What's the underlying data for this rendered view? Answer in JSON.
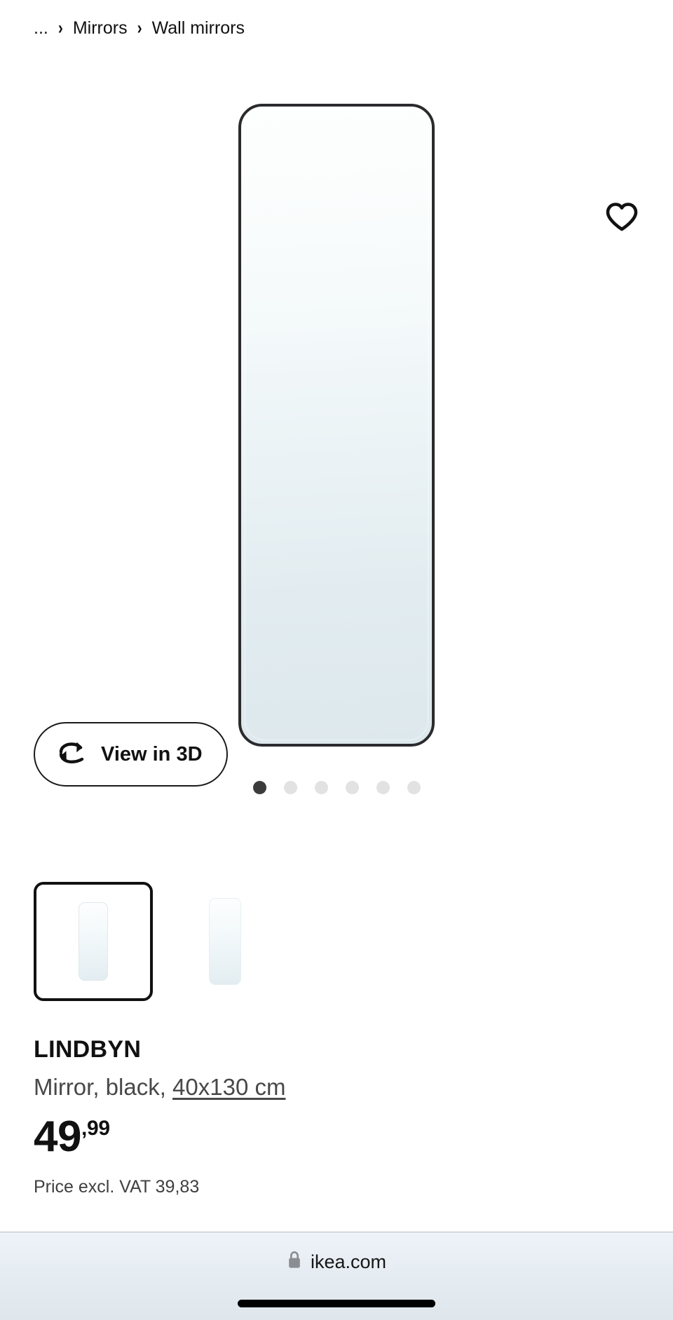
{
  "breadcrumb": {
    "items": [
      {
        "label": "...",
        "name": "breadcrumb-ellipsis"
      },
      {
        "label": "Mirrors",
        "name": "breadcrumb-mirrors"
      },
      {
        "label": "Wall mirrors",
        "name": "breadcrumb-wall-mirrors"
      }
    ],
    "separator": "›"
  },
  "gallery": {
    "favorite_icon": "heart-icon",
    "view_in_3d": {
      "label": "View in 3D",
      "icon": "rotate-360-icon"
    },
    "dots": {
      "count": 6,
      "active_index": 0,
      "active_color": "#3b3b3b",
      "inactive_color": "#e2e2e2"
    },
    "thumbnails": [
      {
        "name": "thumbnail-1",
        "selected": true,
        "alt": "LINDBYN mirror black front view"
      },
      {
        "name": "thumbnail-2",
        "selected": false,
        "alt": "LINDBYN mirror glass detail"
      }
    ],
    "mirror_colors": {
      "frame": "#2b2b2e",
      "glass_top": "#fdfefe",
      "glass_bottom": "#dde8ed"
    }
  },
  "product": {
    "name": "LINDBYN",
    "description_prefix": "Mirror, black, ",
    "size": "40x130 cm",
    "price_integer": "49",
    "price_decimal": ",99",
    "vat_note": "Price excl. VAT 39,83"
  },
  "browser": {
    "lock_icon": "lock-icon",
    "url": "ikea.com",
    "home_indicator": "home-indicator"
  }
}
